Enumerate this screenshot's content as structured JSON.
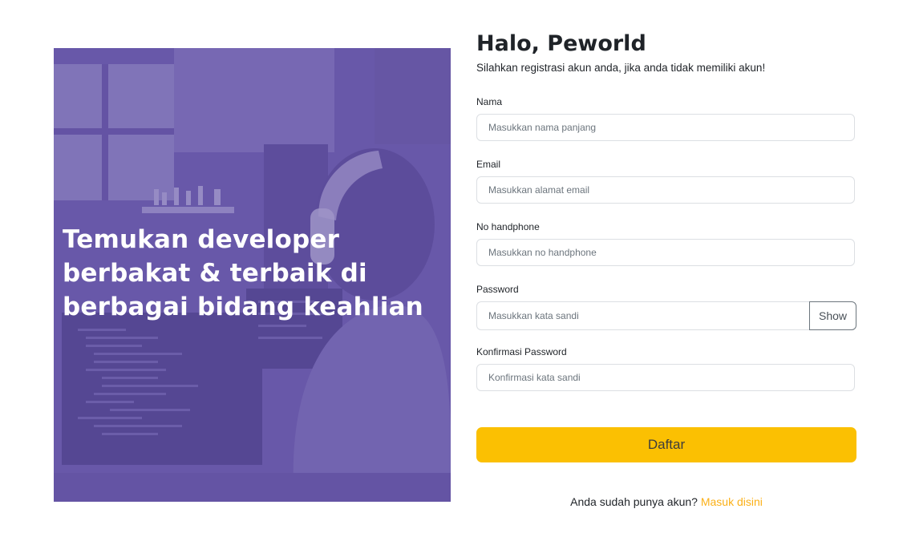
{
  "hero": {
    "tagline_line1": "Temukan developer",
    "tagline_line2": "berbakat & terbaik di",
    "tagline_line3": "berbagai bidang keahlian"
  },
  "form": {
    "title": "Halo, Peworld",
    "subtitle": "Silahkan registrasi akun anda, jika anda tidak memiliki akun!",
    "fields": {
      "name": {
        "label": "Nama",
        "placeholder": "Masukkan nama panjang",
        "value": ""
      },
      "email": {
        "label": "Email",
        "placeholder": "Masukkan alamat email",
        "value": ""
      },
      "phone": {
        "label": "No handphone",
        "placeholder": "Masukkan no handphone",
        "value": ""
      },
      "password": {
        "label": "Password",
        "placeholder": "Masukkan kata sandi",
        "value": "",
        "toggle_label": "Show"
      },
      "confirm_password": {
        "label": "Konfirmasi Password",
        "placeholder": "Konfirmasi kata sandi",
        "value": ""
      }
    },
    "submit_label": "Daftar",
    "login_prompt": "Anda sudah punya akun?",
    "login_link": "Masuk disini"
  },
  "colors": {
    "brand_purple": "#5e50a1",
    "accent_yellow": "#fbc002",
    "link_yellow": "#fbb017"
  }
}
